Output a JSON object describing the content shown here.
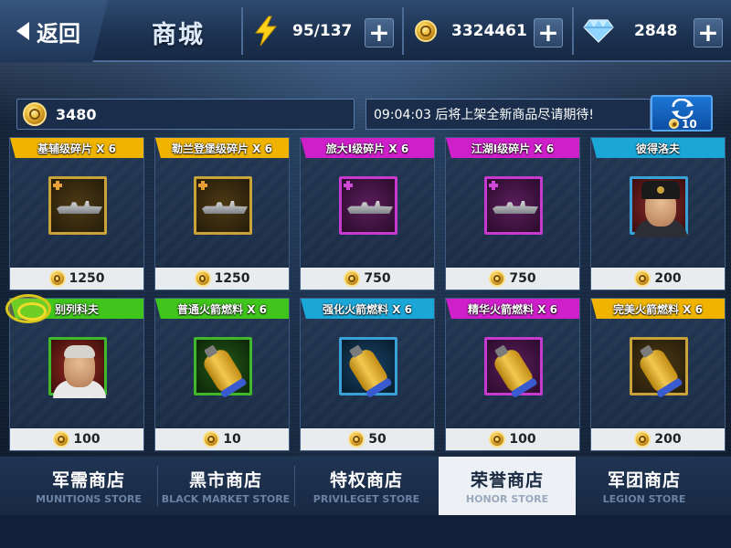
{
  "topbar": {
    "back_label": "返回",
    "title": "商城",
    "energy": {
      "icon": "lightning-icon",
      "value": "95/137"
    },
    "gold": {
      "icon": "gold-medal-icon",
      "value": "3324461"
    },
    "diamond": {
      "icon": "diamond-icon",
      "value": "2848"
    },
    "plus_symbol": "+"
  },
  "honor": {
    "icon": "honor-medal-icon",
    "value": "3480"
  },
  "refresh": {
    "message": "09:04:03 后将上架全新商品尽请期待!",
    "cost": "10",
    "icon": "refresh-icon"
  },
  "products": [
    {
      "name": "基辅级碎片 X 6",
      "banner_color": "#f0b400",
      "frame_color": "#c9a23a",
      "kind": "ship-fragment",
      "price": "1250"
    },
    {
      "name": "勒兰登堡级碎片 X 6",
      "banner_color": "#f0b400",
      "frame_color": "#c9a23a",
      "kind": "ship-fragment",
      "price": "1250"
    },
    {
      "name": "旅大I级碎片 X 6",
      "banner_color": "#cf1fcb",
      "frame_color": "#c63ad0",
      "kind": "ship-fragment",
      "price": "750"
    },
    {
      "name": "江湖I级碎片 X 6",
      "banner_color": "#cf1fcb",
      "frame_color": "#c63ad0",
      "kind": "ship-fragment",
      "price": "750"
    },
    {
      "name": "彼得洛夫",
      "banner_color": "#1aa7d8",
      "frame_color": "#3aa0d8",
      "kind": "officer-hat",
      "price": "200"
    },
    {
      "name": "别列科夫",
      "banner_color": "#3fc51b",
      "frame_color": "#3fb82a",
      "kind": "officer",
      "price": "100"
    },
    {
      "name": "普通火箭燃料 X 6",
      "banner_color": "#3fc51b",
      "frame_color": "#3fb82a",
      "kind": "fuel",
      "price": "10"
    },
    {
      "name": "强化火箭燃料 X 6",
      "banner_color": "#1aa7d8",
      "frame_color": "#3aa0d8",
      "kind": "fuel",
      "price": "50"
    },
    {
      "name": "精华火箭燃料 X 6",
      "banner_color": "#cf1fcb",
      "frame_color": "#c63ad0",
      "kind": "fuel",
      "price": "100"
    },
    {
      "name": "完美火箭燃料 X 6",
      "banner_color": "#f0b400",
      "frame_color": "#c9a23a",
      "kind": "fuel",
      "price": "200"
    }
  ],
  "tabs": [
    {
      "cn": "军需商店",
      "en": "MUNITIONS STORE",
      "active": false
    },
    {
      "cn": "黑市商店",
      "en": "BLACK MARKET STORE",
      "active": false
    },
    {
      "cn": "特权商店",
      "en": "PRIVILEGET STORE",
      "active": false
    },
    {
      "cn": "荣誉商店",
      "en": "HONOR STORE",
      "active": true
    },
    {
      "cn": "军团商店",
      "en": "LEGION STORE",
      "active": false
    }
  ]
}
